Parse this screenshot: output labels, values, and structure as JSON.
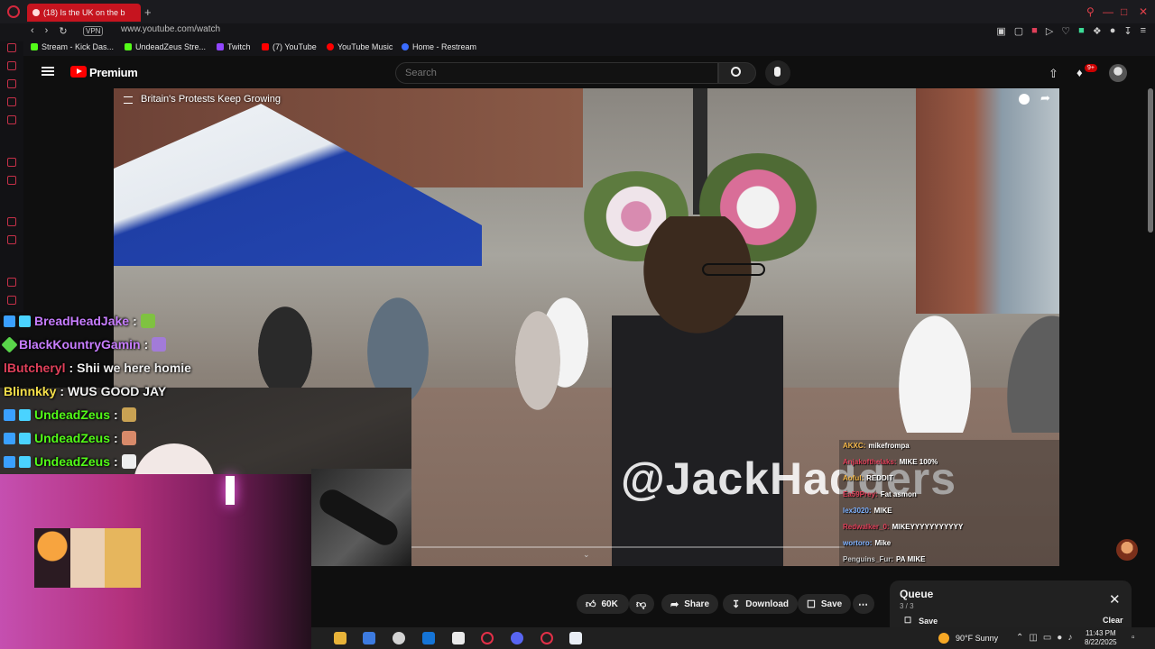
{
  "browser": {
    "tab_title": "(18) Is the UK on the b",
    "new_tab": "+",
    "vpn": "VPN",
    "url": "www.youtube.com/watch",
    "bookmarks": [
      {
        "label": "Stream - Kick Das...",
        "color": "#53fc18"
      },
      {
        "label": "UndeadZeus Stre...",
        "color": "#53fc18"
      },
      {
        "label": "Twitch",
        "color": "#9146ff"
      },
      {
        "label": "(7) YouTube",
        "color": "#ff0000"
      },
      {
        "label": "YouTube Music",
        "color": "#ff0000"
      },
      {
        "label": "Home - Restream",
        "color": "#3a6cff"
      }
    ]
  },
  "youtube": {
    "brand": "Premium",
    "search_placeholder": "Search",
    "notification_count": "9+",
    "video_title": "Britain's Protests Keep Growing",
    "watermark": "@JackHadders",
    "actions": {
      "likes": "60K",
      "share": "Share",
      "download": "Download",
      "save": "Save"
    },
    "queue": {
      "title": "Queue",
      "count": "3 / 3",
      "save": "Save",
      "clear": "Clear"
    }
  },
  "stream_chat": [
    {
      "user": "BreadHeadJake",
      "sep": " :",
      "text": "",
      "color": "#c77dff"
    },
    {
      "user": "BlackKountryGamin",
      "sep": " :",
      "text": "",
      "color": "#c77dff"
    },
    {
      "user": "lButcheryl",
      "sep": " :",
      "text": "Shii we here homie",
      "color": "#e0405a"
    },
    {
      "user": "Blinnkky",
      "sep": " :",
      "text": "WUS GOOD JAY",
      "color": "#f5e04a"
    },
    {
      "user": "UndeadZeus",
      "sep": " :",
      "text": "",
      "color": "#53fc18"
    },
    {
      "user": "UndeadZeus",
      "sep": " :",
      "text": "",
      "color": "#53fc18"
    },
    {
      "user": "UndeadZeus",
      "sep": " :",
      "text": "",
      "color": "#53fc18"
    }
  ],
  "mini_chat": [
    {
      "user": "AKXC:",
      "text": "mikefrompa",
      "color": "#f5b84a"
    },
    {
      "user": "Anjakofthelaks:",
      "text": "MIKE 100%",
      "color": "#e0405a"
    },
    {
      "user": "Aoful:",
      "text": "REDDIT",
      "color": "#f5b84a"
    },
    {
      "user": "Ea59Prey:",
      "text": "Fat asmon",
      "color": "#e0405a"
    },
    {
      "user": "lex3020:",
      "text": "MIKE",
      "color": "#7fb2ff"
    },
    {
      "user": "Redwalker_0:",
      "text": "MIKEYYYYYYYYYYY",
      "color": "#e0405a"
    },
    {
      "user": "wortoro:",
      "text": "Mike",
      "color": "#7fb2ff"
    },
    {
      "user": "Penguins_Fur:",
      "text": "PA MIKE",
      "color": "#c9c9c9"
    }
  ],
  "taskbar": {
    "weather": "90°F  Sunny",
    "time": "11:43 PM",
    "date": "8/22/2025"
  },
  "icons": [
    "opera-icon",
    "back-icon",
    "forward-icon",
    "reload-icon",
    "hamburger-icon",
    "search-icon",
    "mic-icon",
    "upload-icon",
    "bell-icon",
    "like-icon",
    "dislike-icon",
    "share-icon",
    "download-icon",
    "save-icon",
    "more-icon",
    "close-icon",
    "weather-icon"
  ]
}
